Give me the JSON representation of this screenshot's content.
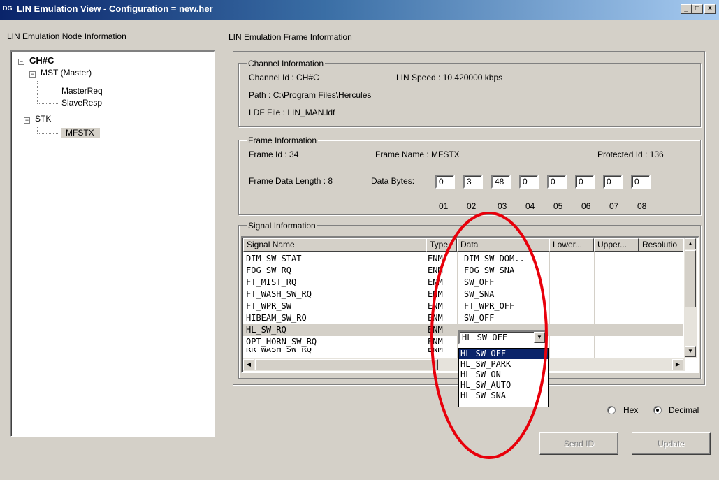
{
  "window": {
    "icon_text": "DG",
    "title": "LIN Emulation View  - Configuration = new.her",
    "min_label": "_",
    "max_label": "□",
    "close_label": "X"
  },
  "node_panel": {
    "title": "LIN Emulation Node Information",
    "tree": {
      "root": "CH#C",
      "nodes": [
        {
          "label": "MST  (Master)",
          "children": [
            "MasterReq",
            "SlaveResp"
          ]
        },
        {
          "label": "STK",
          "children": [
            "MFSTX"
          ]
        }
      ],
      "selected": "MFSTX"
    }
  },
  "frame_panel": {
    "title": "LIN Emulation Frame Information",
    "channel": {
      "group_title": "Channel Information",
      "channel_id": "Channel Id :  CH#C",
      "lin_speed": "LIN Speed :  10.420000 kbps",
      "path": "Path :  C:\\Program Files\\Hercules",
      "ldf_file": "LDF File :   LIN_MAN.ldf"
    },
    "frame": {
      "group_title": "Frame Information",
      "frame_id": "Frame Id :   34",
      "frame_name": "Frame Name :  MFSTX",
      "protected_id": "Protected Id :  136",
      "data_length": "Frame Data Length :  8",
      "data_bytes_label": "Data Bytes:",
      "bytes": [
        "0",
        "3",
        "48",
        "0",
        "0",
        "0",
        "0",
        "0"
      ],
      "byte_indices": [
        "01",
        "02",
        "03",
        "04",
        "05",
        "06",
        "07",
        "08"
      ]
    },
    "signals": {
      "group_title": "Signal Information",
      "columns": [
        "Signal Name",
        "Type",
        "Data",
        "Lower...",
        "Upper...",
        "Resolutio"
      ],
      "rows": [
        {
          "name": "DIM_SW_STAT",
          "type": "ENM",
          "data": "DIM_SW_DOM.."
        },
        {
          "name": "FOG_SW_RQ",
          "type": "ENM",
          "data": "FOG_SW_SNA"
        },
        {
          "name": "FT_MIST_RQ",
          "type": "ENM",
          "data": "SW_OFF"
        },
        {
          "name": "FT_WASH_SW_RQ",
          "type": "ENM",
          "data": "SW_SNA"
        },
        {
          "name": "FT_WPR_SW",
          "type": "ENM",
          "data": "FT_WPR_OFF"
        },
        {
          "name": "HIBEAM_SW_RQ",
          "type": "ENM",
          "data": "SW_OFF"
        },
        {
          "name": "HL_SW_RQ",
          "type": "ENM",
          "data": ""
        },
        {
          "name": "OPT_HORN_SW_RQ",
          "type": "ENM",
          "data": ""
        },
        {
          "name": "RR_WASH_SW_RQ",
          "type": "ENM",
          "data": ""
        }
      ],
      "selected_row": 6,
      "combo_value": "HL_SW_OFF",
      "dropdown_options": [
        "HL_SW_OFF",
        "HL_SW_PARK",
        "HL_SW_ON",
        "HL_SW_AUTO",
        "HL_SW_SNA"
      ],
      "dropdown_selected": 0
    },
    "format": {
      "hex_label": "Hex",
      "decimal_label": "Decimal",
      "selected": "Decimal"
    },
    "buttons": {
      "send_id": "Send ID",
      "update": "Update"
    }
  },
  "colors": {
    "title_gradient_start": "#0a246a",
    "selection": "#0a246a",
    "annotation": "#e8000b",
    "face": "#d4d0c8"
  }
}
